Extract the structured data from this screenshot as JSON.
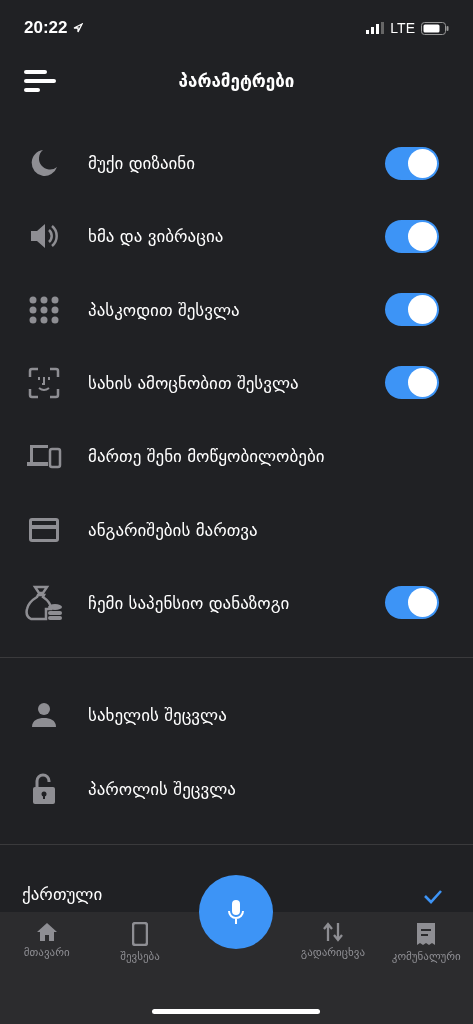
{
  "status_bar": {
    "time": "20:22",
    "network": "LTE"
  },
  "header": {
    "title": "პარამეტრები"
  },
  "settings": [
    {
      "label": "მუქი დიზაინი",
      "kind": "toggle",
      "on": true
    },
    {
      "label": "ხმა და ვიბრაცია",
      "kind": "toggle",
      "on": true
    },
    {
      "label": "პასკოდით შესვლა",
      "kind": "toggle",
      "on": true
    },
    {
      "label": "სახის ამოცნობით შესვლა",
      "kind": "toggle",
      "on": true
    },
    {
      "label": "მართე შენი მოწყობილობები",
      "kind": "link"
    },
    {
      "label": "ანგარიშების მართვა",
      "kind": "link"
    },
    {
      "label": "ჩემი საპენსიო დანაზოგი",
      "kind": "toggle",
      "on": true
    }
  ],
  "account": [
    {
      "label": "სახელის შეცვლა"
    },
    {
      "label": "პაროლის შეცვლა"
    }
  ],
  "languages": [
    {
      "label": "ქართული",
      "selected": true
    }
  ],
  "nav": [
    {
      "label": "მთავარი"
    },
    {
      "label": "შევსება"
    },
    {
      "label": "გადარიცხვა"
    },
    {
      "label": "კომუნალური"
    }
  ]
}
